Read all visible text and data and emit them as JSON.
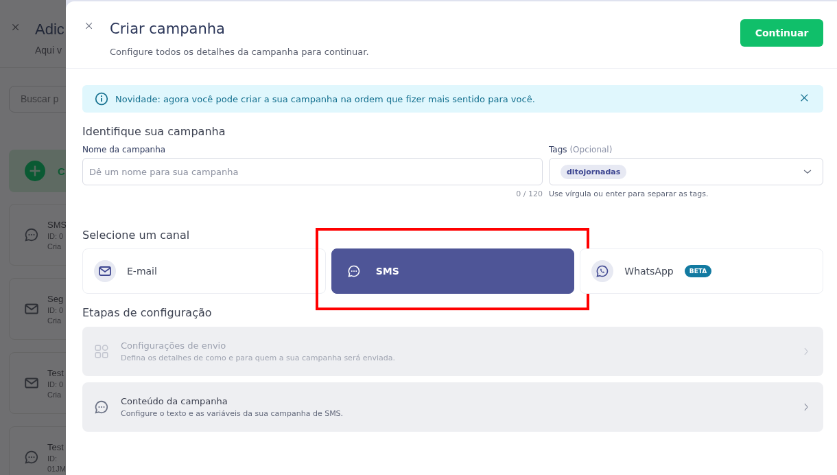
{
  "background_page": {
    "title": "Adic",
    "subtitle": "Aqui v",
    "search": {
      "placeholder": "Buscar p"
    },
    "create_card": {
      "label": "C"
    },
    "items": [
      {
        "kind": "sms",
        "title": "SMS",
        "lines": [
          "ID: 0",
          "Cria"
        ]
      },
      {
        "kind": "email",
        "title": "Seg",
        "lines": [
          "ID: 0",
          "Cria"
        ]
      },
      {
        "kind": "email",
        "title": "Test",
        "lines": [
          "ID: 0",
          "Cria"
        ]
      },
      {
        "kind": "sms",
        "title": "Test",
        "lines": [
          "ID:",
          "01JM"
        ]
      }
    ]
  },
  "modal": {
    "title": "Criar campanha",
    "subtitle": "Configure todos os detalhes da campanha para continuar.",
    "primary_button": "Continuar",
    "notice": "Novidade: agora você pode criar a sua campanha na ordem que fizer mais sentido para você.",
    "identify": {
      "heading": "Identifique sua campanha",
      "name_label": "Nome da campanha",
      "name_placeholder": "Dê um nome para sua campanha",
      "counter": "0 / 120",
      "tags_label": "Tags",
      "tags_optional": "(Opcional)",
      "tags": [
        "ditojornadas"
      ],
      "tags_hint": "Use vírgula ou enter para separar as tags."
    },
    "channel_section": {
      "heading": "Selecione um canal",
      "channels": [
        {
          "kind": "email",
          "label": "E-mail",
          "selected": false,
          "highlighted": false
        },
        {
          "kind": "sms",
          "label": "SMS",
          "selected": true,
          "highlighted": true
        },
        {
          "kind": "whatsapp",
          "label": "WhatsApp",
          "badge": "BETA",
          "selected": false,
          "highlighted": false
        }
      ]
    },
    "steps_section": {
      "heading": "Etapas de configuração",
      "steps": [
        {
          "kind": "grid",
          "title": "Configurações de envio",
          "description": "Defina os detalhes de como e para quem a sua campanha será enviada.",
          "disabled": true
        },
        {
          "kind": "chat",
          "title": "Conteúdo da campanha",
          "description": "Configure o texto e as variáveis da sua campanha de SMS.",
          "disabled": false
        }
      ]
    }
  }
}
